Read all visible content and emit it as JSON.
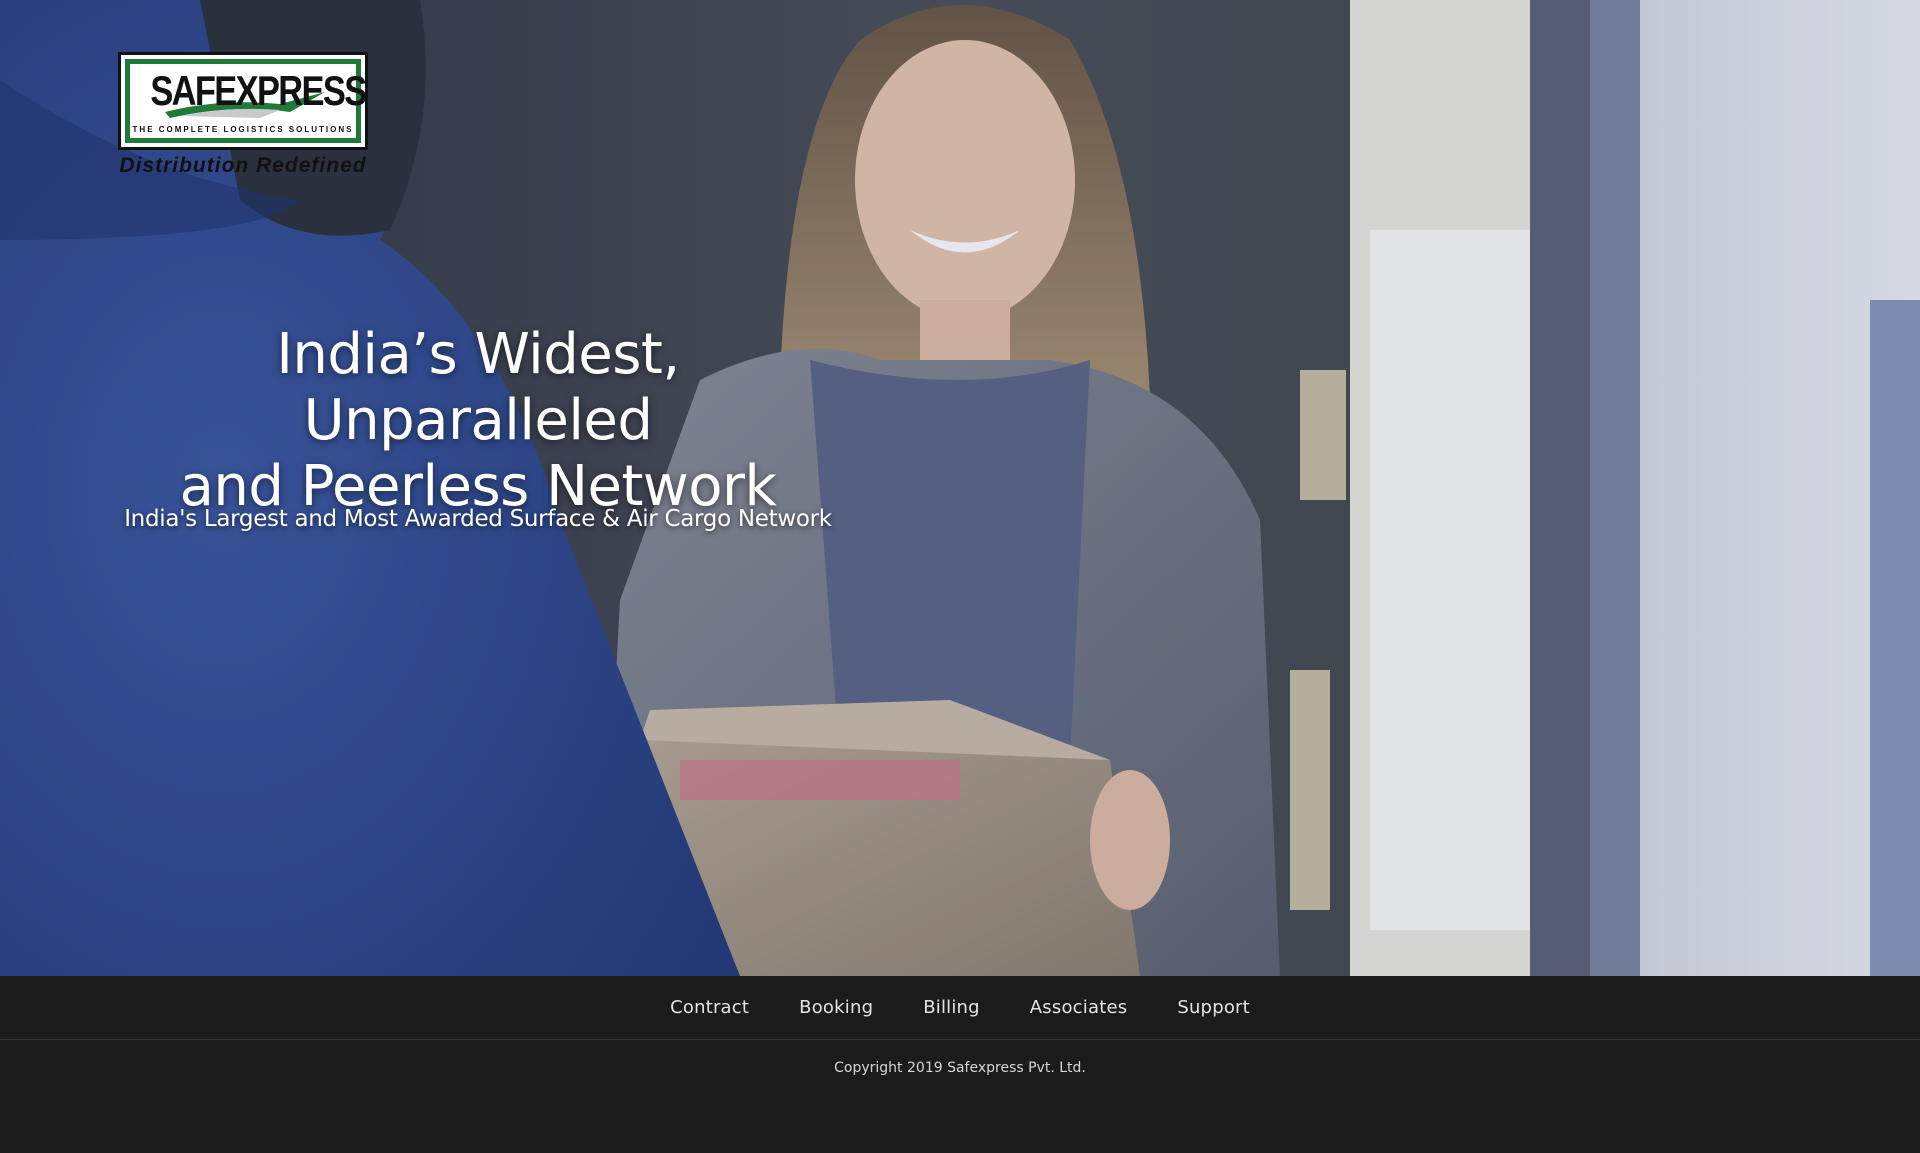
{
  "logo": {
    "brand": "SAFEXPRESS",
    "tagline": "THE COMPLETE LOGISTICS SOLUTIONS",
    "subtitle": "Distribution Redefined"
  },
  "hero": {
    "headline_line1": "India’s Widest, Unparalleled",
    "headline_line2": "and Peerless Network",
    "subheadline": "India's Largest and Most Awarded Surface & Air Cargo Network"
  },
  "footer": {
    "nav": [
      {
        "label": "Contract"
      },
      {
        "label": "Booking"
      },
      {
        "label": "Billing"
      },
      {
        "label": "Associates"
      },
      {
        "label": "Support"
      }
    ],
    "copyright": "Copyright 2019 Safexpress Pvt. Ltd."
  },
  "colors": {
    "footer_bg": "#1b1b1b",
    "logo_green": "#1f7a3a",
    "hero_text": "#ffffff"
  }
}
